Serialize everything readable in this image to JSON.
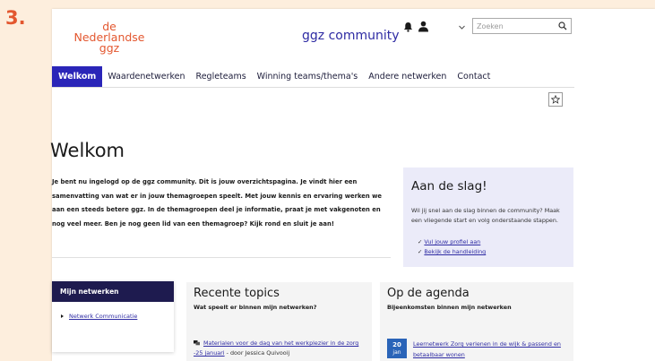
{
  "step_label": "3.",
  "header": {
    "logo_lines": [
      "de",
      "Nederlandse",
      "ggz"
    ],
    "brand": "ggz community",
    "search_placeholder": "Zoeken"
  },
  "nav": {
    "items": [
      {
        "label": "Welkom",
        "active": true
      },
      {
        "label": "Waardenetwerken"
      },
      {
        "label": "Regleteams"
      },
      {
        "label": "Winning teams/thema's"
      },
      {
        "label": "Andere netwerken"
      },
      {
        "label": "Contact"
      }
    ]
  },
  "icons": {
    "bell": "bell-icon",
    "user": "user-icon",
    "chevron": "chevron-down-icon",
    "search": "search-icon",
    "star": "star-icon"
  },
  "main": {
    "title": "Welkom",
    "intro": "Je bent nu ingelogd op de ggz community. Dit is jouw overzichtspagina. Je vindt hier een samenvatting van wat er in jouw themagroepen speelt. Met jouw kennis en ervaring werken we aan een steeds betere ggz. In de themagroepen deel je informatie, praat je met vakgenoten en nog veel meer. Ben je nog geen lid van een themagroep? Kijk rond en sluit je aan!"
  },
  "aan_de_slag": {
    "title": "Aan de slag!",
    "description": "Wil jij snel aan de slag binnen de community? Maak een vliegende start en volg onderstaande stappen.",
    "links": [
      {
        "check": "✓",
        "label": "Vul jouw profiel aan"
      },
      {
        "check": "✓",
        "label": "Bekijk de handleiding"
      }
    ]
  },
  "mijn_netwerken": {
    "title": "Mijn netwerken",
    "items": [
      "Netwerk Communicatie"
    ]
  },
  "recente_topics": {
    "title": "Recente topics",
    "subtitle": "Wat speelt er binnen mijn netwerken?",
    "items": [
      {
        "title": "Materialen voor de dag van het werkplezier in de zorg -25 januari",
        "meta": " - door Jessica Quivooij"
      }
    ]
  },
  "agenda": {
    "title": "Op de agenda",
    "subtitle": "Bijeenkomsten binnen mijn netwerken",
    "items": [
      {
        "day": "20",
        "month": "jan",
        "title": "Leernetwerk Zorg verlenen in de wijk & passend en betaalbaar wonen"
      }
    ]
  },
  "colors": {
    "background": "#fdeedd",
    "accent_orange": "#e3572f",
    "nav_active": "#2a25b8",
    "brand_blue": "#2e2ba3",
    "panel_dark": "#1e1b4f",
    "date_blue": "#2a64b8"
  }
}
